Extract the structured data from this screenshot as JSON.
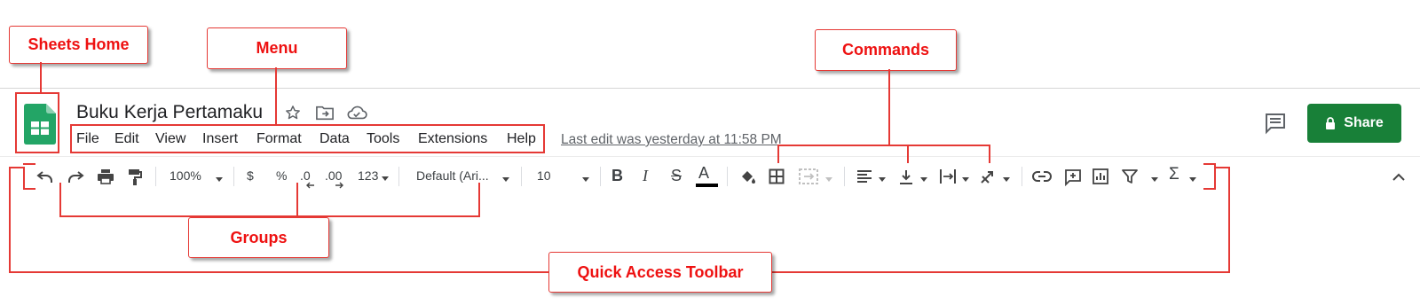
{
  "document": {
    "title": "Buku Kerja Pertamaku",
    "last_edit": "Last edit was yesterday at 11:58 PM"
  },
  "menu": [
    "File",
    "Edit",
    "View",
    "Insert",
    "Format",
    "Data",
    "Tools",
    "Extensions",
    "Help"
  ],
  "share_label": "Share",
  "toolbar": {
    "zoom": "100%",
    "currency": "$",
    "percent": "%",
    "decrease_decimal": ".0",
    "increase_decimal": ".00",
    "more_formats": "123",
    "font": "Default (Ari...",
    "font_size": "10",
    "bold": "B",
    "italic": "I",
    "strikethrough": "S",
    "text_color": "A",
    "sum": "Σ"
  },
  "annotations": {
    "sheets_home": "Sheets Home",
    "menu": "Menu",
    "commands": "Commands",
    "groups": "Groups",
    "quick_access": "Quick Access Toolbar"
  },
  "colors": {
    "annotation_red": "#e53935",
    "share_green": "#188038",
    "sheets_green": "#23a566"
  }
}
